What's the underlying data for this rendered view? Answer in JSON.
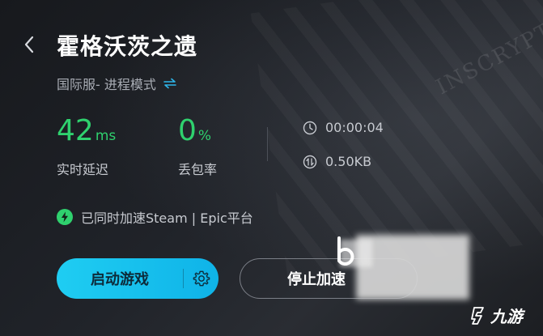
{
  "game": {
    "title": "霍格沃茨之遗",
    "mode": "国际服- 进程模式"
  },
  "stats": {
    "latency": {
      "value": "42",
      "unit": "ms",
      "label": "实时延迟"
    },
    "packet_loss": {
      "value": "0",
      "unit": "%",
      "label": "丢包率"
    },
    "duration": "00:00:04",
    "traffic": "0.50KB"
  },
  "acceleration_note": "已同时加速Steam | Epic平台",
  "buttons": {
    "start": "启动游戏",
    "stop": "停止加速"
  },
  "background_watermark": "INSCRYPT",
  "brand": {
    "name": "九游"
  },
  "colors": {
    "accent_green": "#2fd16e",
    "primary_button": "#1fcdf2",
    "swap_icon": "#2eb6ea"
  },
  "icons": {
    "back": "chevron-left-icon",
    "swap": "swap-icon",
    "clock": "clock-icon",
    "traffic": "traffic-icon",
    "lightning": "lightning-icon",
    "gear": "gear-icon"
  }
}
